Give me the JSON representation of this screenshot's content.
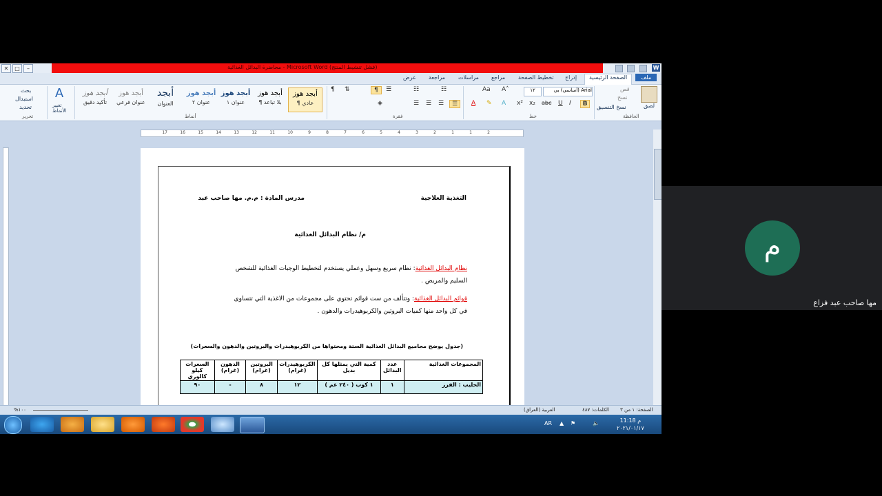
{
  "window": {
    "title": "محاضرة البدائل الغذائية - Microsoft Word (فشل تنشيط المنتج)",
    "app_icon": "W"
  },
  "tabs": [
    "ملف",
    "الصفحة الرئيسية",
    "إدراج",
    "تخطيط الصفحة",
    "مراجع",
    "مراسلات",
    "مراجعة",
    "عرض"
  ],
  "ribbon": {
    "clipboard": {
      "paste": "لصق",
      "cut": "قص",
      "copy": "نسخ",
      "format_painter": "نسخ التنسيق",
      "group": "الحافظة"
    },
    "font": {
      "name": "Arial (أساسي) بي",
      "size": "١٢",
      "group": "خط",
      "bold": "B",
      "italic": "I",
      "underline": "U",
      "strike": "abc"
    },
    "paragraph": {
      "group": "فقرة"
    },
    "styles": {
      "group": "أنماط",
      "items": [
        {
          "preview": "أبجد هوز",
          "name": "¶ عادي"
        },
        {
          "preview": "أبجد هوز",
          "name": "¶ بلا تباعد"
        },
        {
          "preview": "أبجد هوز",
          "name": "عنوان ١"
        },
        {
          "preview": "أبجد هوز",
          "name": "عنوان ٢"
        },
        {
          "preview": "أبجد",
          "name": "العنوان"
        },
        {
          "preview": "أبجد هوز",
          "name": "عنوان فرعي"
        },
        {
          "preview": "أبجد هوز",
          "name": "تأكيد دقيق"
        }
      ],
      "change_styles": "تغيير الأنماط"
    },
    "editing": {
      "find": "بحث",
      "replace": "استبدال",
      "select": "تحديد",
      "group": "تحرير"
    }
  },
  "ruler_numbers": [
    "2",
    "1",
    "1",
    "2",
    "3",
    "4",
    "5",
    "6",
    "7",
    "8",
    "9",
    "10",
    "11",
    "12",
    "13",
    "14",
    "15",
    "16",
    "17"
  ],
  "document": {
    "header_right": "التغذية العلاجية",
    "header_left": "مدرس المادة : م.م. مها صاحب عبد",
    "title": "م/ نظام البدائل الغذائية",
    "p1_term": "نظام البدائل الغذائية",
    "p1_text": ": نظام سريع وسهل وعملي يستخدم لتخطيط الوجبات الغذائية للشخص",
    "p1_line2": "السليم والمريض .",
    "p2_term": "قوائم البدائل الغذائية",
    "p2_text": ": وتتألف من ست قوائم تحتوي على مجموعات من الاغذية التي تتساوى",
    "p2_line2": "في كل واحد منها كميات البروتين والكربوهيدرات والدهون .",
    "table_caption": "(جدول يوضح مجاميع البدائل الغذائية الستة ومحتواها من الكربوهيدرات والبروتين والدهون والسعرات)",
    "table_headers": [
      "المجموعات الغذائية",
      "عدد البدائل",
      "كمية التي يمثلها كل بديل",
      "الكربوهيدرات (غرام)",
      "البروتين (غرام)",
      "الدهون (غرام)",
      "السعرات كيلو كالوري"
    ],
    "table_rows": [
      [
        "الحليب : الفرز",
        "١",
        "١ كوب ( ٢٤٠ غم )",
        "١٢",
        "٨",
        "-",
        "٩٠"
      ]
    ]
  },
  "status": {
    "page": "الصفحة: ١ من ٣",
    "words": "الكلمات: ٤٨٧",
    "language": "العربية (العراق)",
    "zoom": "%١٠٠"
  },
  "taskbar": {
    "time": "11:18 م",
    "date": "٢٠٢١/٠١/١٧",
    "lang": "AR"
  },
  "participant": {
    "initial": "م",
    "name": "مها صاحب عبد فزاع"
  },
  "colors": {
    "titlebar_red": "#f20d0d",
    "term_red": "#e00000",
    "table_cyan": "#cfeef2",
    "avatar": "#1e6e55"
  }
}
